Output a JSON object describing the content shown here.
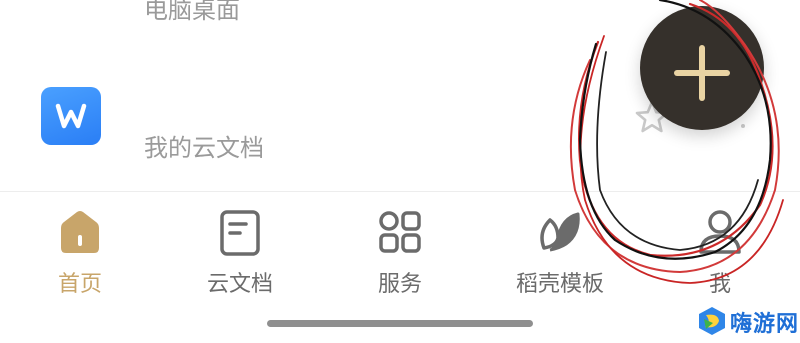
{
  "list": {
    "partial_row_label": "电脑桌面",
    "doc_row": {
      "icon_letter": "W",
      "label": "我的云文档",
      "star_icon": "star-outline-icon"
    }
  },
  "fab": {
    "icon": "plus-icon",
    "background": "#35302b",
    "icon_color": "#e9d3a3"
  },
  "tabs": [
    {
      "label": "首页",
      "icon": "home-icon",
      "active": true
    },
    {
      "label": "云文档",
      "icon": "cloud-doc-icon",
      "active": false
    },
    {
      "label": "服务",
      "icon": "grid-icon",
      "active": false
    },
    {
      "label": "稻壳模板",
      "icon": "leaf-icon",
      "active": false
    },
    {
      "label": "我",
      "icon": "person-icon",
      "active": false
    }
  ],
  "colors": {
    "accent": "#c8a56a",
    "inactive": "#6b6b6b",
    "muted_text": "#9a9a9a"
  },
  "watermark": {
    "text": "嗨游网"
  }
}
